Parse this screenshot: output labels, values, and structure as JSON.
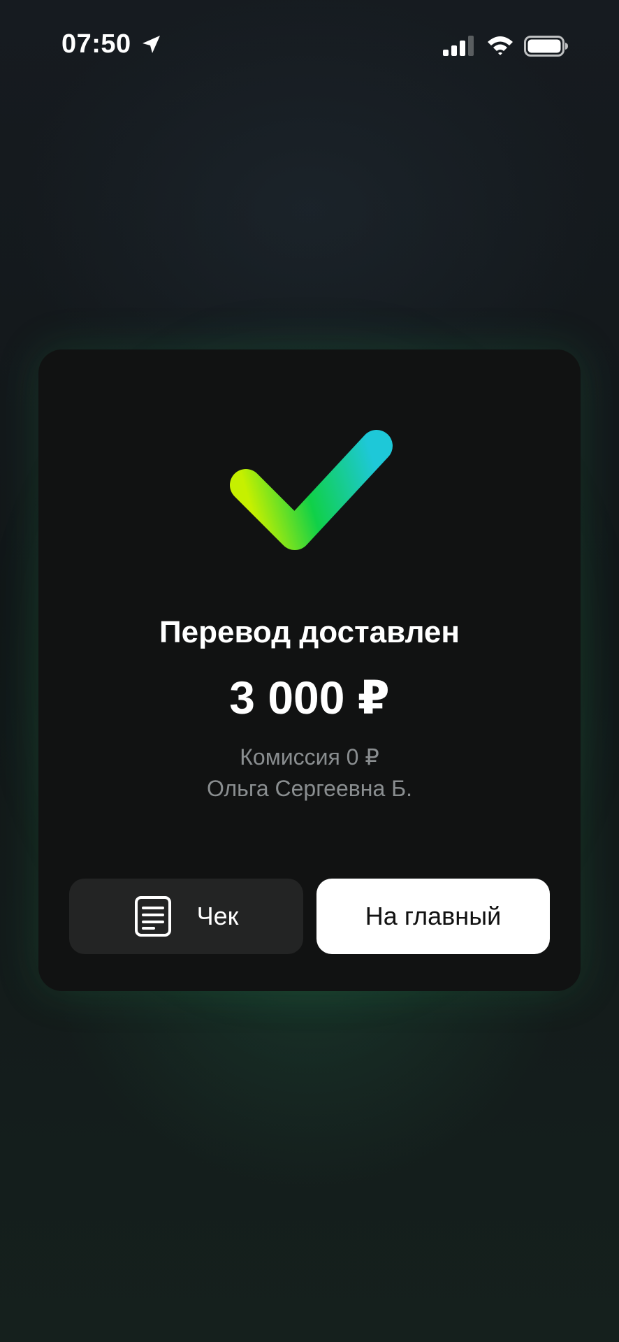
{
  "status_bar": {
    "time": "07:50",
    "icons": [
      "location-arrow-icon",
      "cellular-signal-icon",
      "wifi-icon",
      "battery-icon"
    ]
  },
  "result": {
    "icon": "success-checkmark-icon",
    "title": "Перевод доставлен",
    "amount": "3 000 ₽",
    "commission": "Комиссия 0 ₽",
    "recipient": "Ольга Сергеевна Б."
  },
  "actions": {
    "receipt_label": "Чек",
    "receipt_icon": "document-icon",
    "home_label": "На главный"
  },
  "colors": {
    "card_background": "#111212",
    "check_gradient_start": "#c6f000",
    "check_gradient_mid": "#10d048",
    "check_gradient_end": "#1ec8d8",
    "primary_button": "#ffffff",
    "secondary_button": "#232424",
    "muted_text": "#8a8e90"
  }
}
